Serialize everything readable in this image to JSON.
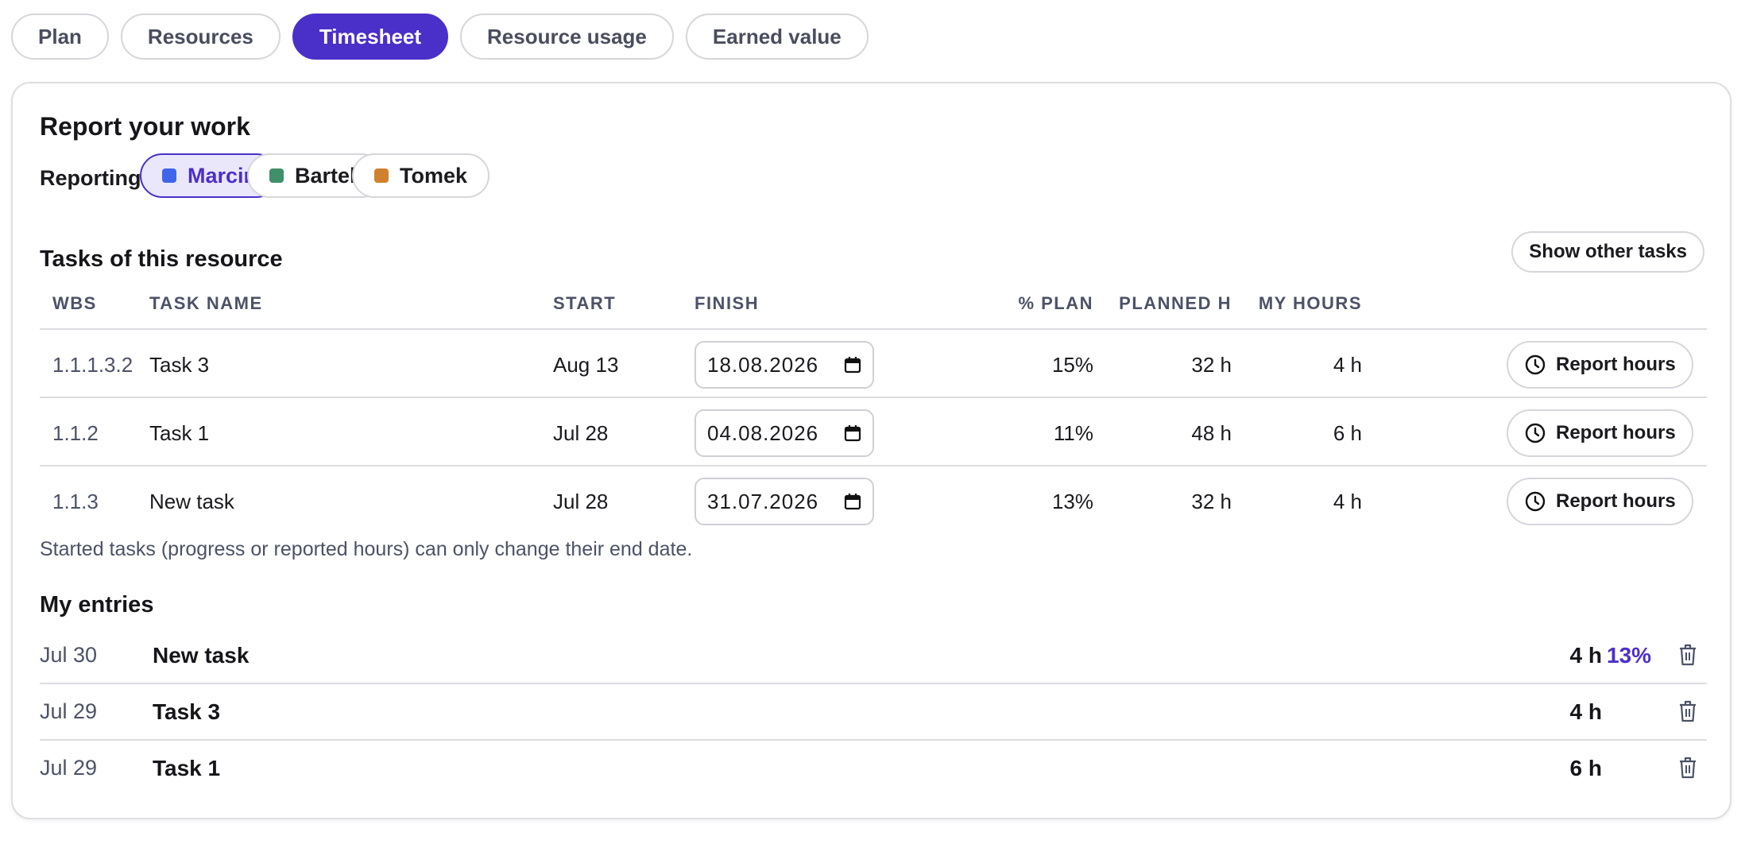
{
  "tabs": [
    "Plan",
    "Resources",
    "Timesheet",
    "Resource usage",
    "Earned value"
  ],
  "active_tab": "Timesheet",
  "report": {
    "title": "Report your work",
    "reporting_as_label": "Reporting as:",
    "people": [
      {
        "name": "Marcin",
        "color": "#3f66e8",
        "selected": true
      },
      {
        "name": "Bartek",
        "color": "#3f8f6a",
        "selected": false
      },
      {
        "name": "Tomek",
        "color": "#d0812e",
        "selected": false
      }
    ]
  },
  "tasks_section": {
    "title": "Tasks of this resource",
    "show_other_label": "Show other tasks",
    "columns": {
      "wbs": "WBS",
      "task_name": "TASK NAME",
      "start": "START",
      "finish": "FINISH",
      "pct_plan": "% PLAN",
      "planned_h": "PLANNED H",
      "my_hours": "MY HOURS"
    },
    "rows": [
      {
        "wbs": "1.1.1.3.2",
        "name": "Task 3",
        "start": "Aug 13",
        "finish": "18.08.2026",
        "pct_plan": "15%",
        "planned_h": "32 h",
        "my_hours": "4 h",
        "action": "Report hours"
      },
      {
        "wbs": "1.1.2",
        "name": "Task 1",
        "start": "Jul 28",
        "finish": "04.08.2026",
        "pct_plan": "11%",
        "planned_h": "48 h",
        "my_hours": "6 h",
        "action": "Report hours"
      },
      {
        "wbs": "1.1.3",
        "name": "New task",
        "start": "Jul 28",
        "finish": "31.07.2026",
        "pct_plan": "13%",
        "planned_h": "32 h",
        "my_hours": "4 h",
        "action": "Report hours"
      }
    ],
    "note": "Started tasks (progress or reported hours) can only change their end date."
  },
  "entries_section": {
    "title": "My entries",
    "entries": [
      {
        "date": "Jul 30",
        "task": "New task",
        "hours": "4 h",
        "pct": "13%"
      },
      {
        "date": "Jul 29",
        "task": "Task 3",
        "hours": "4 h",
        "pct": ""
      },
      {
        "date": "Jul 29",
        "task": "Task 1",
        "hours": "6 h",
        "pct": ""
      }
    ]
  },
  "colors": {
    "accent": "#4b2fc9",
    "muted": "#4c5266",
    "border": "#d6d6dc"
  }
}
